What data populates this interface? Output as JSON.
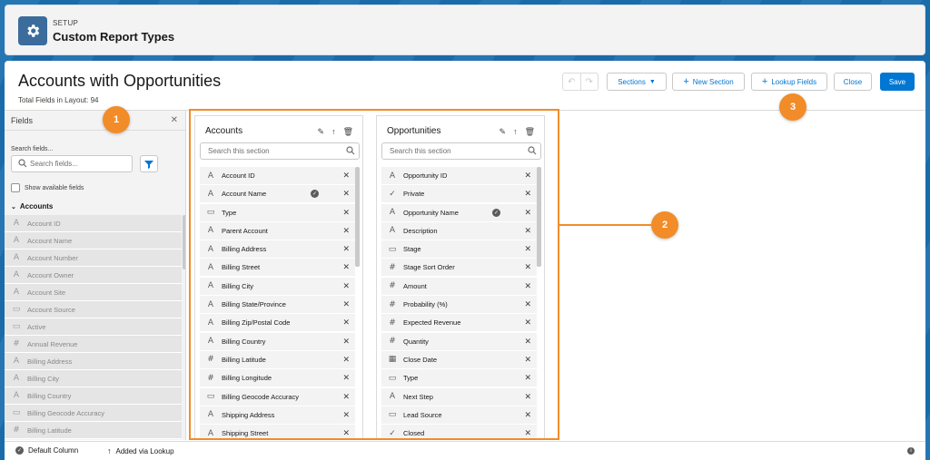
{
  "header": {
    "label": "SETUP",
    "title": "Custom Report Types",
    "icon": "gear-icon"
  },
  "page": {
    "title": "Accounts with Opportunities",
    "subtitle": "Total Fields in Layout: 94"
  },
  "toolbar": {
    "sections_label": "Sections",
    "new_section_label": "New Section",
    "lookup_fields_label": "Lookup Fields",
    "close_label": "Close",
    "save_label": "Save"
  },
  "fields_panel": {
    "title": "Fields",
    "search_label": "Search fields...",
    "search_placeholder": "Search fields...",
    "show_available_label": "Show available fields",
    "group_label": "Accounts",
    "items": [
      {
        "icon": "A",
        "label": "Account ID"
      },
      {
        "icon": "A",
        "label": "Account Name"
      },
      {
        "icon": "A",
        "label": "Account Number"
      },
      {
        "icon": "A",
        "label": "Account Owner"
      },
      {
        "icon": "A",
        "label": "Account Site"
      },
      {
        "icon": "▭",
        "label": "Account Source"
      },
      {
        "icon": "▭",
        "label": "Active"
      },
      {
        "icon": "#",
        "label": "Annual Revenue"
      },
      {
        "icon": "A",
        "label": "Billing Address"
      },
      {
        "icon": "A",
        "label": "Billing City"
      },
      {
        "icon": "A",
        "label": "Billing Country"
      },
      {
        "icon": "▭",
        "label": "Billing Geocode Accuracy"
      },
      {
        "icon": "#",
        "label": "Billing Latitude"
      }
    ]
  },
  "badges": {
    "one": "1",
    "two": "2",
    "three": "3"
  },
  "sections": [
    {
      "title": "Accounts",
      "search_placeholder": "Search this section",
      "items": [
        {
          "icon": "A",
          "label": "Account ID",
          "default": false
        },
        {
          "icon": "A",
          "label": "Account Name",
          "default": true
        },
        {
          "icon": "▭",
          "label": "Type",
          "default": false
        },
        {
          "icon": "A",
          "label": "Parent Account",
          "default": false
        },
        {
          "icon": "A",
          "label": "Billing Address",
          "default": false
        },
        {
          "icon": "A",
          "label": "Billing Street",
          "default": false
        },
        {
          "icon": "A",
          "label": "Billing City",
          "default": false
        },
        {
          "icon": "A",
          "label": "Billing State/Province",
          "default": false
        },
        {
          "icon": "A",
          "label": "Billing Zip/Postal Code",
          "default": false
        },
        {
          "icon": "A",
          "label": "Billing Country",
          "default": false
        },
        {
          "icon": "#",
          "label": "Billing Latitude",
          "default": false
        },
        {
          "icon": "#",
          "label": "Billing Longitude",
          "default": false
        },
        {
          "icon": "▭",
          "label": "Billing Geocode Accuracy",
          "default": false
        },
        {
          "icon": "A",
          "label": "Shipping Address",
          "default": false
        },
        {
          "icon": "A",
          "label": "Shipping Street",
          "default": false
        }
      ]
    },
    {
      "title": "Opportunities",
      "search_placeholder": "Search this section",
      "items": [
        {
          "icon": "A",
          "label": "Opportunity ID",
          "default": false
        },
        {
          "icon": "✓",
          "label": "Private",
          "default": false
        },
        {
          "icon": "A",
          "label": "Opportunity Name",
          "default": true
        },
        {
          "icon": "A",
          "label": "Description",
          "default": false
        },
        {
          "icon": "▭",
          "label": "Stage",
          "default": false
        },
        {
          "icon": "#",
          "label": "Stage Sort Order",
          "default": false
        },
        {
          "icon": "#",
          "label": "Amount",
          "default": false
        },
        {
          "icon": "#",
          "label": "Probability (%)",
          "default": false
        },
        {
          "icon": "#",
          "label": "Expected Revenue",
          "default": false
        },
        {
          "icon": "#",
          "label": "Quantity",
          "default": false
        },
        {
          "icon": "▦",
          "label": "Close Date",
          "default": false
        },
        {
          "icon": "▭",
          "label": "Type",
          "default": false
        },
        {
          "icon": "A",
          "label": "Next Step",
          "default": false
        },
        {
          "icon": "▭",
          "label": "Lead Source",
          "default": false
        },
        {
          "icon": "✓",
          "label": "Closed",
          "default": false
        }
      ]
    }
  ],
  "footer": {
    "default_column_label": "Default Column",
    "lookup_label": "Added via Lookup"
  },
  "colors": {
    "brand": "#0176d3",
    "annotation": "#f28c28",
    "header_icon_bg": "#3b6c9c"
  }
}
